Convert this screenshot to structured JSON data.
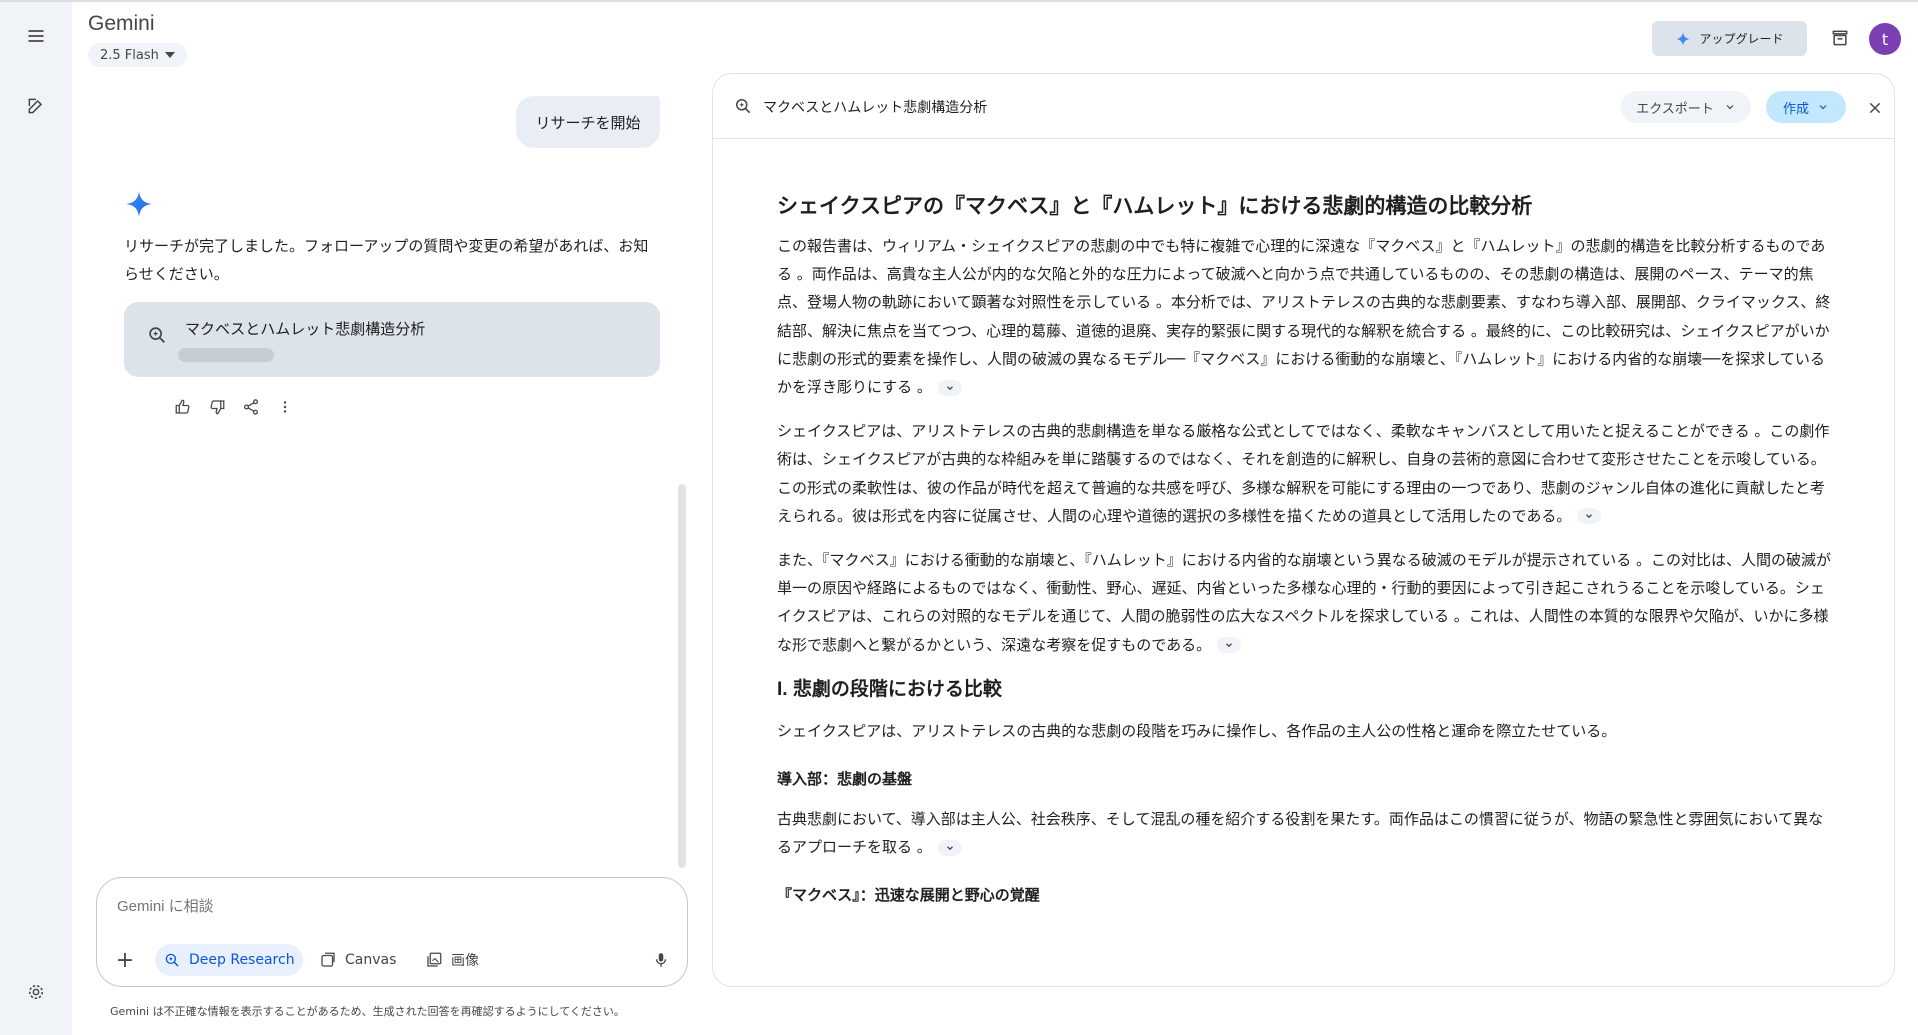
{
  "app": {
    "title": "Gemini",
    "model": "2.5 Flash",
    "upgrade_label": "アップグレード",
    "avatar_initial": "t"
  },
  "chat": {
    "user_message": "リサーチを開始",
    "assistant_reply": "リサーチが完了しました。フォローアップの質問や変更の希望があれば、お知らせください。",
    "research_card_title": "マクベスとハムレット悲劇構造分析"
  },
  "input": {
    "placeholder": "Gemini に相談",
    "tools": [
      "Deep Research",
      "Canvas",
      "画像"
    ],
    "disclaimer": "Gemini は不正確な情報を表示することがあるため、生成された回答を再確認するようにしてください。"
  },
  "panel": {
    "title": "マクベスとハムレット悲劇構造分析",
    "export_label": "エクスポート",
    "create_label": "作成"
  },
  "document": {
    "heading": "シェイクスピアの『マクベス』と『ハムレット』における悲劇的構造の比較分析",
    "p1": "この報告書は、ウィリアム・シェイクスピアの悲劇の中でも特に複雑で心理的に深遠な『マクベス』と『ハムレット』の悲劇的構造を比較分析するものである 。両作品は、高貴な主人公が内的な欠陥と外的な圧力によって破滅へと向かう点で共通しているものの、その悲劇の構造は、展開のペース、テーマ的焦点、登場人物の軌跡において顕著な対照性を示している 。本分析では、アリストテレスの古典的な悲劇要素、すなわち導入部、展開部、クライマックス、終結部、解決に焦点を当てつつ、心理的葛藤、道徳的退廃、実存的緊張に関する現代的な解釈を統合する 。最終的に、この比較研究は、シェイクスピアがいかに悲劇の形式的要素を操作し、人間の破滅の異なるモデル──『マクベス』における衝動的な崩壊と、『ハムレット』における内省的な崩壊──を探求しているかを浮き彫りにする 。",
    "p2": "シェイクスピアは、アリストテレスの古典的悲劇構造を単なる厳格な公式としてではなく、柔軟なキャンバスとして用いたと捉えることができる 。この劇作術は、シェイクスピアが古典的な枠組みを単に踏襲するのではなく、それを創造的に解釈し、自身の芸術的意図に合わせて変形させたことを示唆している。この形式の柔軟性は、彼の作品が時代を超えて普遍的な共感を呼び、多様な解釈を可能にする理由の一つであり、悲劇のジャンル自体の進化に貢献したと考えられる。彼は形式を内容に従属させ、人間の心理や道徳的選択の多様性を描くための道具として活用したのである。",
    "p3": "また、『マクベス』における衝動的な崩壊と、『ハムレット』における内省的な崩壊という異なる破滅のモデルが提示されている 。この対比は、人間の破滅が単一の原因や経路によるものではなく、衝動性、野心、遅延、内省といった多様な心理的・行動的要因によって引き起こされうることを示唆している。シェイクスピアは、これらの対照的なモデルを通じて、人間の脆弱性の広大なスペクトルを探求している 。これは、人間性の本質的な限界や欠陥が、いかに多様な形で悲劇へと繋がるかという、深遠な考察を促すものである。",
    "section1": "I. 悲劇の段階における比較",
    "p4": "シェイクスピアは、アリストテレスの古典的な悲劇の段階を巧みに操作し、各作品の主人公の性格と運命を際立たせている。",
    "sub1": "導入部：悲劇の基盤",
    "p5": "古典悲劇において、導入部は主人公、社会秩序、そして混乱の種を紹介する役割を果たす。両作品はこの慣習に従うが、物語の緊急性と雰囲気において異なるアプローチを取る 。",
    "sub2": "『マクベス』：迅速な展開と野心の覚醒"
  }
}
